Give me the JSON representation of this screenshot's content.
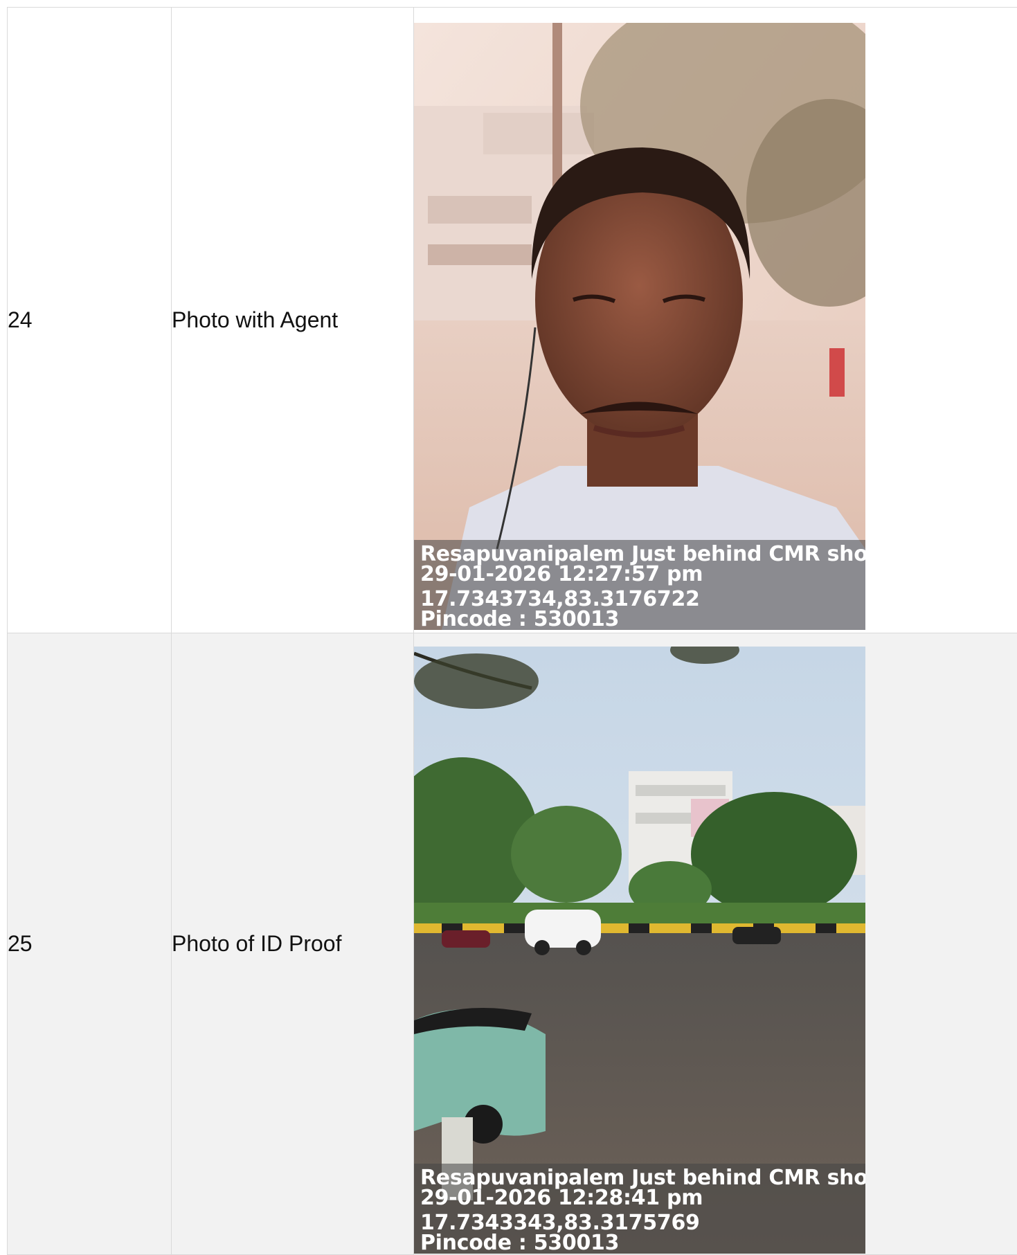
{
  "rows": [
    {
      "number": "24",
      "label": "Photo with Agent",
      "photo_stamp": {
        "location": "Resapuvanipalem Just behind CMR shoppin",
        "datetime": "29-01-2026 12:27:57 pm",
        "coordinates": "17.7343734,83.3176722",
        "pincode": "Pincode : 530013"
      }
    },
    {
      "number": "25",
      "label": "Photo of ID Proof",
      "photo_stamp": {
        "location": "Resapuvanipalem Just behind CMR shoppin",
        "datetime": "29-01-2026 12:28:41 pm",
        "coordinates": "17.7343343,83.3175769",
        "pincode": "Pincode : 530013"
      }
    }
  ]
}
